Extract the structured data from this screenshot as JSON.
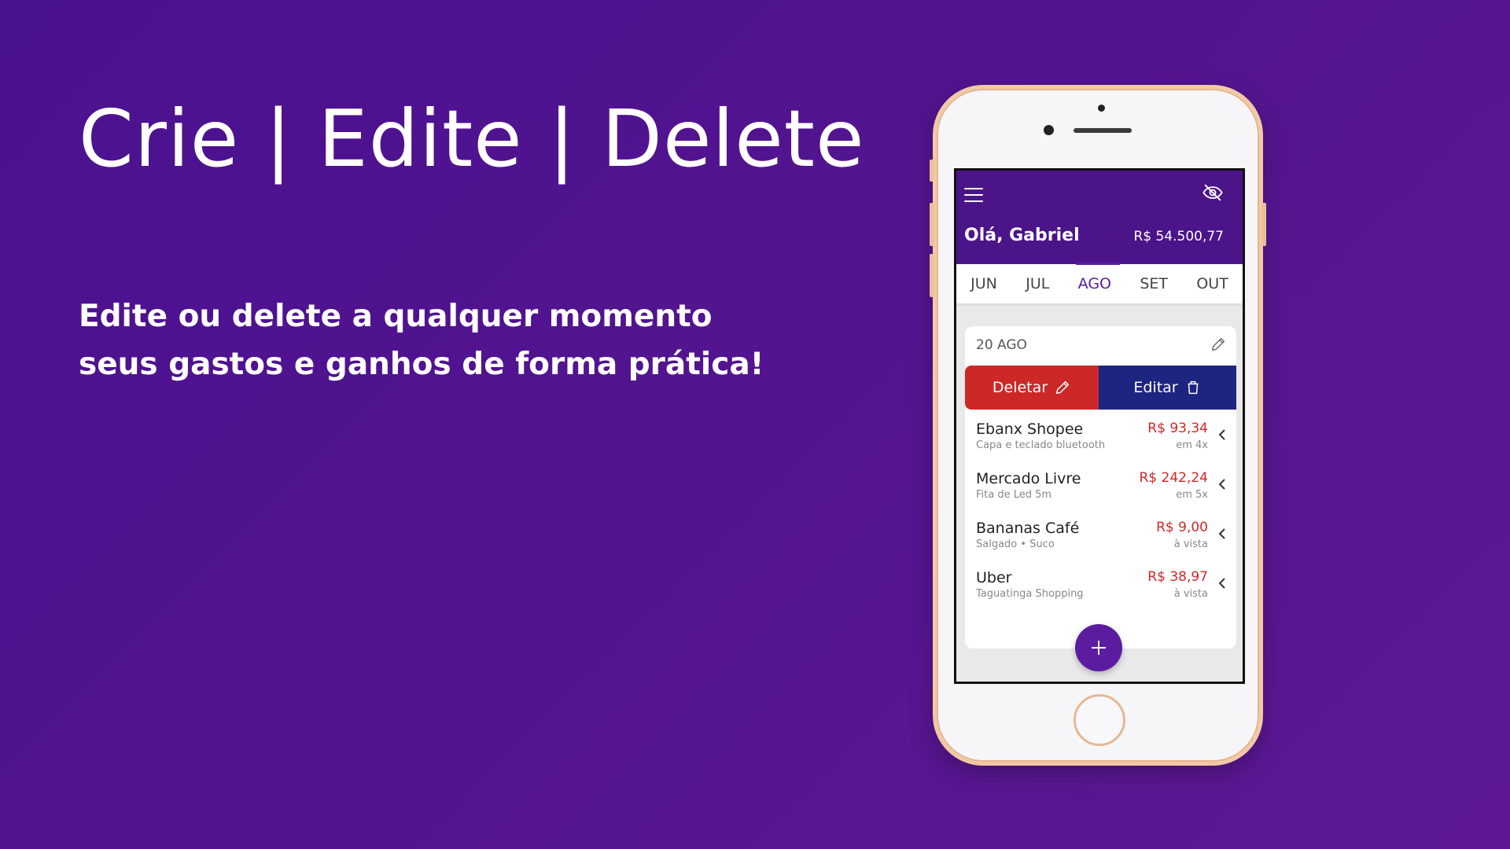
{
  "hero": {
    "title": "Crie | Edite | Delete",
    "subtitle": "Edite ou delete a qualquer momento seus gastos e ganhos de forma prática!"
  },
  "app": {
    "greeting": "Olá, Gabriel",
    "balance": "R$ 54.500,77",
    "months": [
      "JUN",
      "JUL",
      "AGO",
      "SET",
      "OUT"
    ],
    "active_month": "AGO",
    "card": {
      "date": "20 AGO",
      "delete_label": "Deletar",
      "edit_label": "Editar"
    },
    "transactions": [
      {
        "name": "Ebanx Shopee",
        "desc": "Capa e teclado bluetooth",
        "amount": "R$ 93,34",
        "installments": "em 4x"
      },
      {
        "name": "Mercado Livre",
        "desc": "Fita de Led 5m",
        "amount": "R$ 242,24",
        "installments": "em 5x"
      },
      {
        "name": "Bananas Café",
        "desc": "Salgado • Suco",
        "amount": "R$ 9,00",
        "installments": "à vista"
      },
      {
        "name": "Uber",
        "desc": "Taguatinga Shopping",
        "amount": "R$ 38,97",
        "installments": "à vista"
      }
    ]
  },
  "colors": {
    "background": "#52128f",
    "header": "#4c1489",
    "accent": "#5b1ca0",
    "delete": "#cc2828",
    "edit": "#1e2580",
    "expense": "#d32626",
    "income": "#19b56a"
  },
  "icons": [
    "menu-icon",
    "eye-off-icon",
    "pencil-icon",
    "trash-icon",
    "chevron-left-icon",
    "plus-icon"
  ]
}
